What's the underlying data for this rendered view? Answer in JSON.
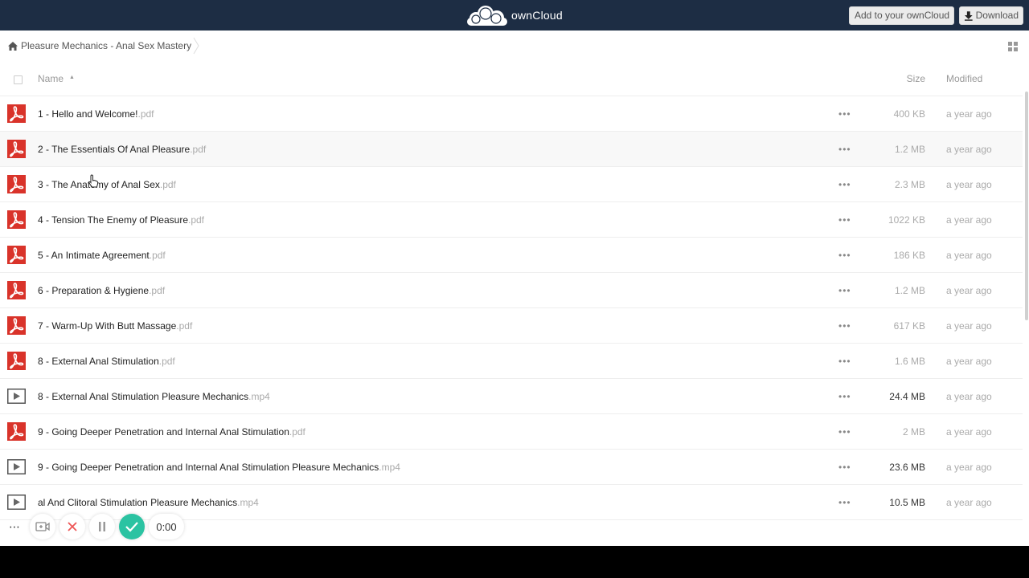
{
  "header": {
    "brand": "ownCloud",
    "add_label": "Add to your ownCloud",
    "download_label": "Download",
    "bg_color": "#1d2d44"
  },
  "breadcrumb": {
    "home_icon": "home-icon",
    "folder": "Pleasure Mechanics - Anal Sex Mastery"
  },
  "table": {
    "headers": {
      "name": "Name",
      "size": "Size",
      "modified": "Modified"
    },
    "rows": [
      {
        "type": "pdf",
        "name": "1 - Hello and Welcome!",
        "ext": ".pdf",
        "size": "400 KB",
        "modified": "a year ago",
        "size_big": false
      },
      {
        "type": "pdf",
        "name": "2 - The Essentials Of Anal Pleasure",
        "ext": ".pdf",
        "size": "1.2 MB",
        "modified": "a year ago",
        "size_big": false
      },
      {
        "type": "pdf",
        "name": "3 - The Anatomy of Anal Sex",
        "ext": ".pdf",
        "size": "2.3 MB",
        "modified": "a year ago",
        "size_big": false
      },
      {
        "type": "pdf",
        "name": "4 - Tension The Enemy of Pleasure",
        "ext": ".pdf",
        "size": "1022 KB",
        "modified": "a year ago",
        "size_big": false
      },
      {
        "type": "pdf",
        "name": "5 - An Intimate Agreement",
        "ext": ".pdf",
        "size": "186 KB",
        "modified": "a year ago",
        "size_big": false
      },
      {
        "type": "pdf",
        "name": "6 - Preparation & Hygiene",
        "ext": ".pdf",
        "size": "1.2 MB",
        "modified": "a year ago",
        "size_big": false
      },
      {
        "type": "pdf",
        "name": "7 - Warm-Up With Butt Massage",
        "ext": ".pdf",
        "size": "617 KB",
        "modified": "a year ago",
        "size_big": false
      },
      {
        "type": "pdf",
        "name": "8 - External Anal Stimulation",
        "ext": ".pdf",
        "size": "1.6 MB",
        "modified": "a year ago",
        "size_big": false
      },
      {
        "type": "video",
        "name": "8 - External Anal Stimulation Pleasure Mechanics",
        "ext": ".mp4",
        "size": "24.4 MB",
        "modified": "a year ago",
        "size_big": true
      },
      {
        "type": "pdf",
        "name": "9 - Going Deeper Penetration and Internal Anal Stimulation",
        "ext": ".pdf",
        "size": "2 MB",
        "modified": "a year ago",
        "size_big": false
      },
      {
        "type": "video",
        "name": "9 - Going Deeper Penetration and Internal Anal Stimulation Pleasure Mechanics",
        "ext": ".mp4",
        "size": "23.6 MB",
        "modified": "a year ago",
        "size_big": true
      },
      {
        "type": "video",
        "name": "al And Clitoral Stimulation Pleasure Mechanics",
        "ext": ".mp4",
        "size": "10.5 MB",
        "modified": "a year ago",
        "size_big": true
      }
    ],
    "more_glyph": "•••"
  },
  "recorder": {
    "timer": "0:00",
    "more_glyph": "⋯"
  },
  "colors": {
    "pdf_red": "#d9332a",
    "accent_green": "#2bc3a2"
  }
}
